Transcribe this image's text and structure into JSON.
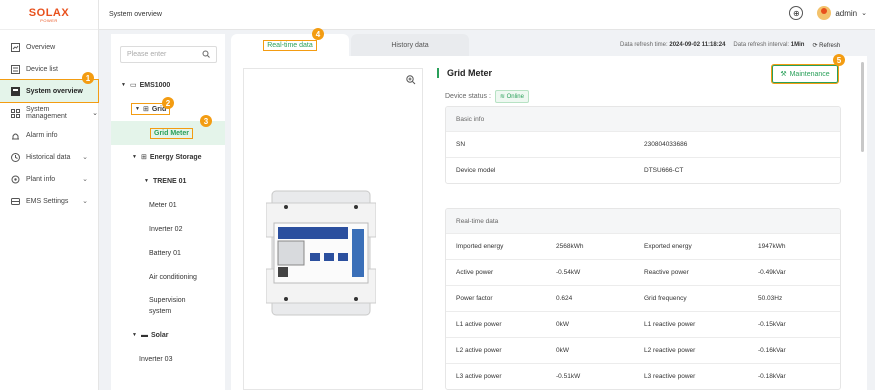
{
  "brand": {
    "logo_main": "SOLA",
    "logo_x": "X",
    "logo_sub": "POWER"
  },
  "sidebar": {
    "items": [
      {
        "label": "Overview",
        "icon": "overview-icon"
      },
      {
        "label": "Device list",
        "icon": "device-list-icon"
      },
      {
        "label": "System overview",
        "icon": "system-overview-icon",
        "active": true
      },
      {
        "label": "System management",
        "icon": "system-management-icon",
        "chev": "⌄"
      },
      {
        "label": "Alarm info",
        "icon": "alarm-icon"
      },
      {
        "label": "Historical data",
        "icon": "history-icon",
        "chev": "⌄"
      },
      {
        "label": "Plant info",
        "icon": "plant-icon",
        "chev": "⌄"
      },
      {
        "label": "EMS Settings",
        "icon": "ems-icon",
        "chev": "⌄"
      }
    ]
  },
  "header": {
    "breadcrumb": "System overview",
    "user": "admin",
    "user_chev": "⌄",
    "globe_icon": "globe-icon"
  },
  "search": {
    "placeholder": "Please enter"
  },
  "tree": {
    "ems": "EMS1000",
    "grid": "Grid",
    "grid_meter": "Grid Meter",
    "energy_storage": "Energy Storage",
    "trene": "TRENE 01",
    "meter": "Meter 01",
    "inverter2": "Inverter 02",
    "battery": "Battery 01",
    "aircon": "Air conditioning",
    "supervision": "Supervision system",
    "solar": "Solar",
    "inverter3": "Inverter 03"
  },
  "tabs": {
    "realtime": "Real-time data",
    "history": "History data"
  },
  "refresh": {
    "time_label": "Data refresh time:",
    "time": "2024-09-02 11:18:24",
    "interval_label": "Data refresh interval:",
    "interval": "1Min",
    "refresh": "Refresh"
  },
  "device": {
    "title": "Grid Meter",
    "status_label": "Device status :",
    "status": "Online",
    "maintenance": "Maintenance"
  },
  "basic": {
    "header": "Basic info",
    "rows": [
      {
        "k": "SN",
        "v": "230804033686"
      },
      {
        "k": "Device model",
        "v": "DTSU666-CT"
      }
    ]
  },
  "realtime": {
    "header": "Real-time data",
    "rows": [
      {
        "k1": "Imported energy",
        "v1": "2568kWh",
        "k2": "Exported energy",
        "v2": "1947kWh"
      },
      {
        "k1": "Active power",
        "v1": "-0.54kW",
        "k2": "Reactive power",
        "v2": "-0.49kVar"
      },
      {
        "k1": "Power factor",
        "v1": "0.624",
        "k2": "Grid frequency",
        "v2": "50.03Hz"
      },
      {
        "k1": "L1 active power",
        "v1": "0kW",
        "k2": "L1 reactive power",
        "v2": "-0.15kVar"
      },
      {
        "k1": "L2 active power",
        "v1": "0kW",
        "k2": "L2 reactive power",
        "v2": "-0.16kVar"
      },
      {
        "k1": "L3 active power",
        "v1": "-0.51kW",
        "k2": "L3 reactive power",
        "v2": "-0.18kVar"
      }
    ]
  },
  "badges": [
    "1",
    "2",
    "3",
    "4",
    "5"
  ],
  "colors": {
    "accent": "#2aa05a",
    "callout": "#f39c12",
    "brand": "#e8501c"
  }
}
